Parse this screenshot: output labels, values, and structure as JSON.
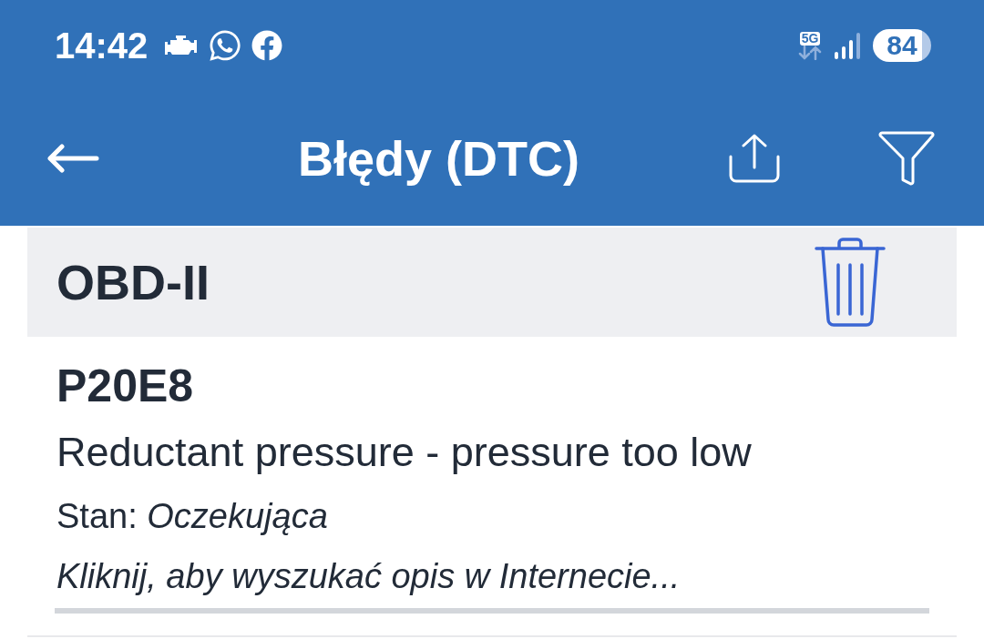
{
  "status_bar": {
    "time": "14:42",
    "network": "5G",
    "battery": "84"
  },
  "header": {
    "title": "Błędy (DTC)"
  },
  "sections": [
    {
      "title": "OBD-II",
      "items": [
        {
          "code": "P20E8",
          "description": "Reductant pressure - pressure too low",
          "status": "Stan: *Oczekująca*",
          "hint": "Kliknij, aby wyszukać opis w Internecie..."
        }
      ]
    }
  ]
}
